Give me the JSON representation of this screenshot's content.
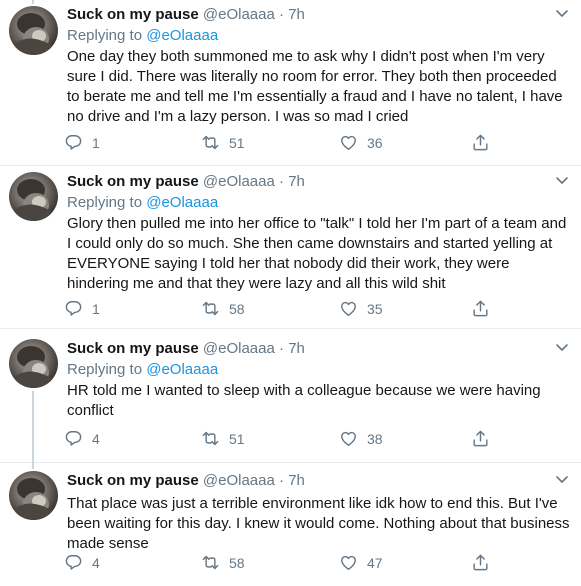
{
  "tweets": [
    {
      "name": "Suck on my pause",
      "handle": "@eOlaaaa",
      "separator": "·",
      "time": "7h",
      "replying_prefix": "Replying to",
      "replying_handle": "@eOlaaaa",
      "text": "One day they both summoned me to ask why I didn't post when I'm very sure I did. There was literally no room for error. They both then proceeded to berate me and tell me I'm essentially a fraud and I have no talent, I have no drive and I'm a lazy person. I was so mad I cried",
      "replies": "1",
      "retweets": "51",
      "likes": "36"
    },
    {
      "name": "Suck on my pause",
      "handle": "@eOlaaaa",
      "separator": "·",
      "time": "7h",
      "replying_prefix": "Replying to",
      "replying_handle": "@eOlaaaa",
      "text": "Glory then pulled me into her office to \"talk\" I told her I'm part of a team and I could only do so much. She then came downstairs and started yelling at EVERYONE saying I told her that nobody did their work, they were hindering me and that they were lazy and all this wild shit",
      "replies": "1",
      "retweets": "58",
      "likes": "35"
    },
    {
      "name": "Suck on my pause",
      "handle": "@eOlaaaa",
      "separator": "·",
      "time": "7h",
      "replying_prefix": "Replying to",
      "replying_handle": "@eOlaaaa",
      "text": "HR told me I wanted to sleep with a colleague because we were having conflict",
      "replies": "4",
      "retweets": "51",
      "likes": "38"
    },
    {
      "name": "Suck on my pause",
      "handle": "@eOlaaaa",
      "separator": "·",
      "time": "7h",
      "replying_prefix": "Replying to",
      "replying_handle": "@eOlaaaa",
      "text": "That place was just a terrible environment like idk how to end this. But I've been waiting for this day. I knew it would come. Nothing about that business made sense",
      "replies": "4",
      "retweets": "58",
      "likes": "47"
    }
  ],
  "colors": {
    "text": "#14171a",
    "muted": "#657786",
    "link": "#1b95e0",
    "divider": "#e6ecf0",
    "thread_line": "#ccd6dd"
  },
  "icons": [
    "avatar-image",
    "chevron-down-icon",
    "reply-icon",
    "retweet-icon",
    "like-icon",
    "share-icon"
  ]
}
